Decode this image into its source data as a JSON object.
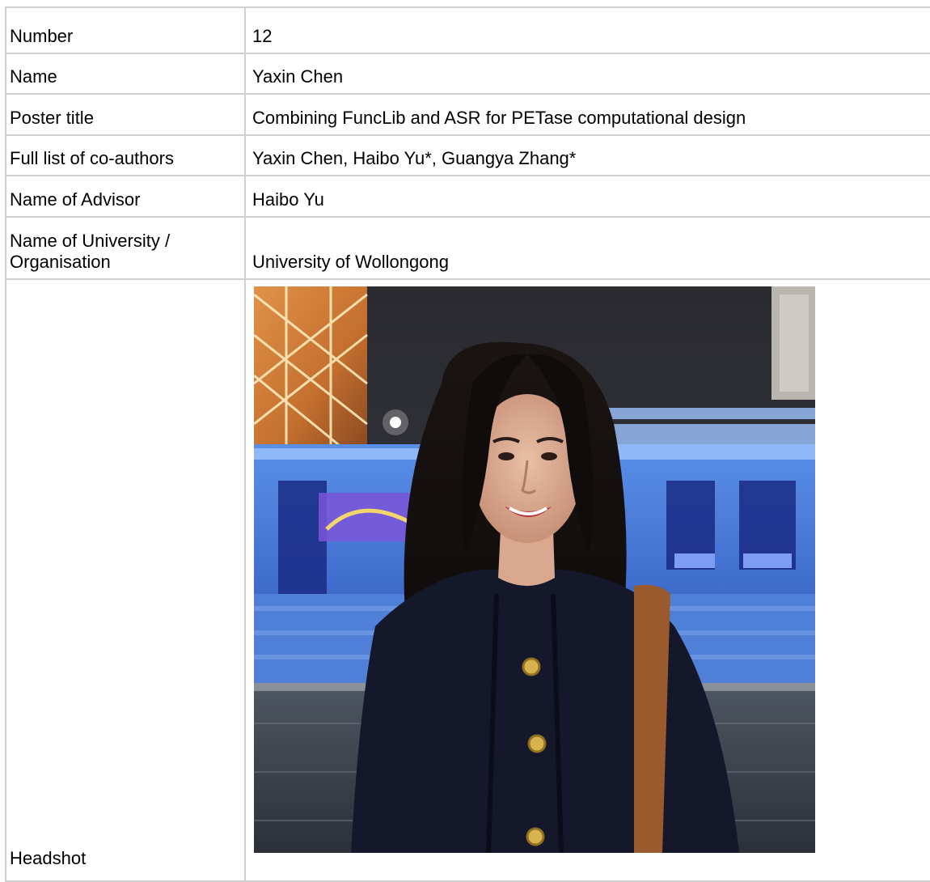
{
  "rows": [
    {
      "label": "Number",
      "value": "12"
    },
    {
      "label": "Name",
      "value": "Yaxin Chen"
    },
    {
      "label": "Poster title",
      "value": "Combining FuncLib and ASR for PETase computational design"
    },
    {
      "label": "Full list of co-authors",
      "value": "Yaxin Chen, Haibo Yu*, Guangya Zhang*"
    },
    {
      "label": "Name of Advisor",
      "value": "Haibo Yu"
    },
    {
      "label": "Name of University /\nOrganisation",
      "value": "University of Wollongong"
    },
    {
      "label": "Headshot"
    }
  ],
  "colors": {
    "border": "#cfcfcf",
    "text": "#000000",
    "background": "#ffffff"
  }
}
